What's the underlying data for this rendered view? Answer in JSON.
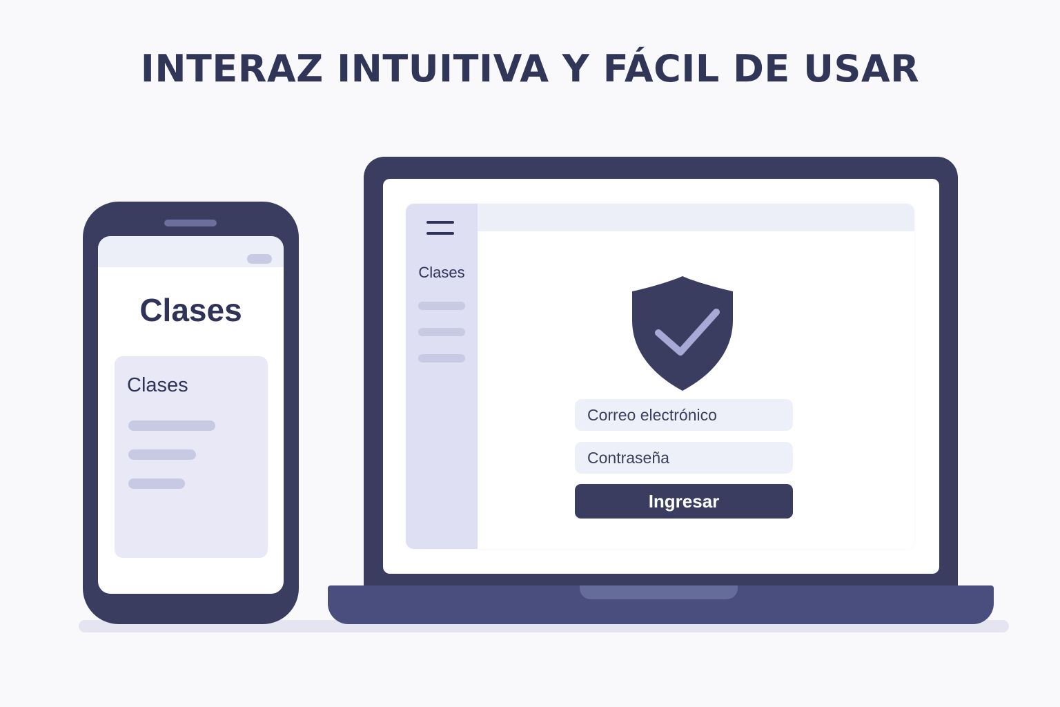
{
  "headline": "INTERAZ INTUITIVA Y FÁCIL DE USAR",
  "phone": {
    "title": "Clases",
    "card_title": "Clases"
  },
  "laptop": {
    "sidebar_label": "Clases",
    "email_placeholder": "Correo electrónico",
    "password_placeholder": "Contraseña",
    "submit_label": "Ingresar"
  },
  "icons": {
    "menu": "hamburger-menu-icon",
    "shield": "shield-check-icon"
  },
  "colors": {
    "primary": "#3a3d60",
    "accent_light": "#dedff3",
    "placeholder_bar": "#c8c9e3",
    "check": "#a7aad6",
    "background": "#f9f9fc"
  }
}
